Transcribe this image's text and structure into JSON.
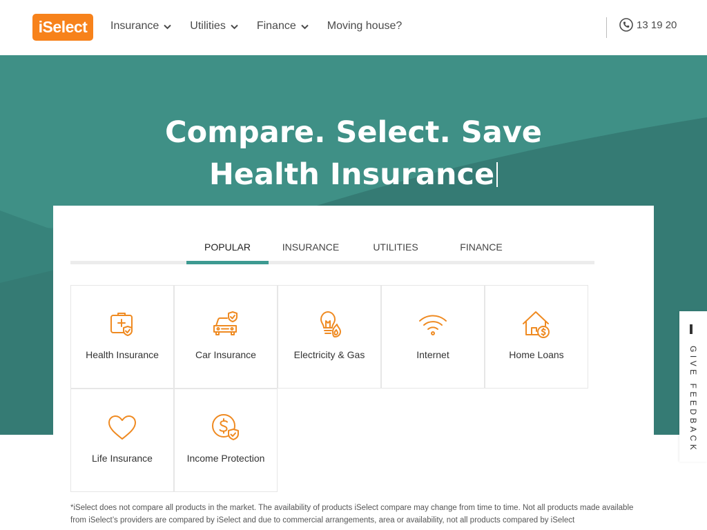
{
  "header": {
    "logo": "iSelect",
    "nav": [
      {
        "label": "Insurance",
        "has_dropdown": true
      },
      {
        "label": "Utilities",
        "has_dropdown": true
      },
      {
        "label": "Finance",
        "has_dropdown": true
      },
      {
        "label": "Moving house?",
        "has_dropdown": false
      }
    ],
    "phone": {
      "icon": "phone-icon",
      "number": "13 19 20"
    }
  },
  "hero": {
    "line1": "Compare. Select. Save",
    "line2": "Health Insurance"
  },
  "tabs": [
    {
      "label": "POPULAR",
      "active": true
    },
    {
      "label": "INSURANCE",
      "active": false
    },
    {
      "label": "UTILITIES",
      "active": false
    },
    {
      "label": "FINANCE",
      "active": false
    }
  ],
  "products": [
    {
      "label": "Health Insurance",
      "icon": "first-aid-kit-icon"
    },
    {
      "label": "Car Insurance",
      "icon": "car-shield-icon"
    },
    {
      "label": "Electricity & Gas",
      "icon": "bulb-flame-icon"
    },
    {
      "label": "Internet",
      "icon": "wifi-icon"
    },
    {
      "label": "Home Loans",
      "icon": "house-dollar-icon"
    },
    {
      "label": "Life Insurance",
      "icon": "heart-icon"
    },
    {
      "label": "Income Protection",
      "icon": "dollar-shield-icon"
    }
  ],
  "disclaimer": "*iSelect does not compare all products in the market. The availability of products iSelect compare may change from time to time. Not all products made available from iSelect’s providers are compared by iSelect and due to commercial arrangements, area or availability, not all products compared by iSelect",
  "feedback": {
    "label": "GIVE FEEDBACK"
  },
  "colors": {
    "brand_orange": "#f7821b",
    "hero_teal": "#3a8880",
    "tab_active": "#3d9a91",
    "icon_orange": "#ef8a21"
  }
}
